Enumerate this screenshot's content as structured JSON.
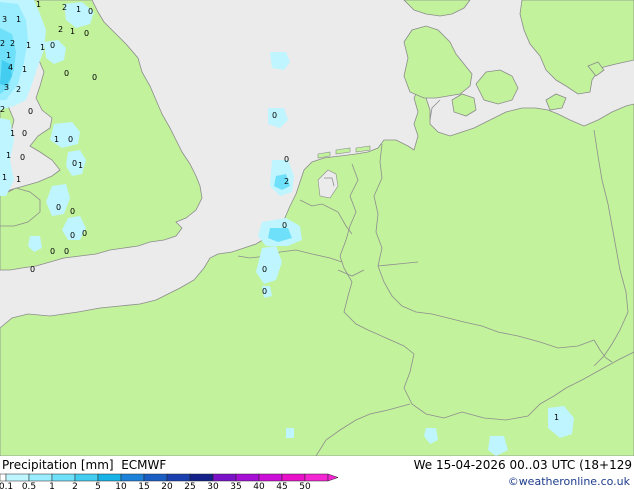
{
  "legend": {
    "title": "Precipitation [mm]  ECMWF",
    "date": "We 15-04-2026 00..03 UTC (18+129",
    "credit": "©weatheronline.co.uk",
    "colorbar": [
      {
        "label": "0.1",
        "color": "#bff5ff"
      },
      {
        "label": "0.5",
        "color": "#9aedff"
      },
      {
        "label": "1",
        "color": "#6fe0fa"
      },
      {
        "label": "2",
        "color": "#43cdf0"
      },
      {
        "label": "5",
        "color": "#18b3e6"
      },
      {
        "label": "10",
        "color": "#1c82d9"
      },
      {
        "label": "15",
        "color": "#1a5ec4"
      },
      {
        "label": "20",
        "color": "#1a3fae"
      },
      {
        "label": "25",
        "color": "#12228a"
      },
      {
        "label": "30",
        "color": "#7a13c8"
      },
      {
        "label": "35",
        "color": "#a50fd6"
      },
      {
        "label": "40",
        "color": "#cc0fd8"
      },
      {
        "label": "45",
        "color": "#e810c8"
      },
      {
        "label": "50",
        "color": "#f425d2"
      }
    ]
  },
  "colors": {
    "land": "#c2f29b",
    "sea": "#ebebeb",
    "border": "#8e8e8e",
    "coast": "#8c8c8c"
  },
  "map": {
    "labels": [
      {
        "text": "3"
      },
      {
        "text": "1"
      },
      {
        "text": "1"
      },
      {
        "text": "2"
      },
      {
        "text": "1"
      },
      {
        "text": "0"
      },
      {
        "text": "2"
      },
      {
        "text": "2"
      },
      {
        "text": "1"
      },
      {
        "text": "1"
      },
      {
        "text": "0"
      },
      {
        "text": "2"
      },
      {
        "text": "1"
      },
      {
        "text": "0"
      },
      {
        "text": "1"
      },
      {
        "text": "4"
      },
      {
        "text": "0"
      },
      {
        "text": "1"
      },
      {
        "text": "0"
      },
      {
        "text": "3"
      },
      {
        "text": "2"
      },
      {
        "text": "2"
      },
      {
        "text": "0"
      },
      {
        "text": "1"
      },
      {
        "text": "0"
      },
      {
        "text": "1"
      },
      {
        "text": "0"
      },
      {
        "text": "1"
      },
      {
        "text": "0"
      },
      {
        "text": "0"
      },
      {
        "text": "1"
      },
      {
        "text": "1"
      },
      {
        "text": "1"
      },
      {
        "text": "0"
      },
      {
        "text": "0"
      },
      {
        "text": "0"
      },
      {
        "text": "0"
      },
      {
        "text": "0"
      },
      {
        "text": "0"
      },
      {
        "text": "0"
      },
      {
        "text": "0"
      },
      {
        "text": "0"
      },
      {
        "text": "0"
      },
      {
        "text": "0"
      },
      {
        "text": "1"
      },
      {
        "text": "0"
      },
      {
        "text": "2"
      }
    ]
  }
}
